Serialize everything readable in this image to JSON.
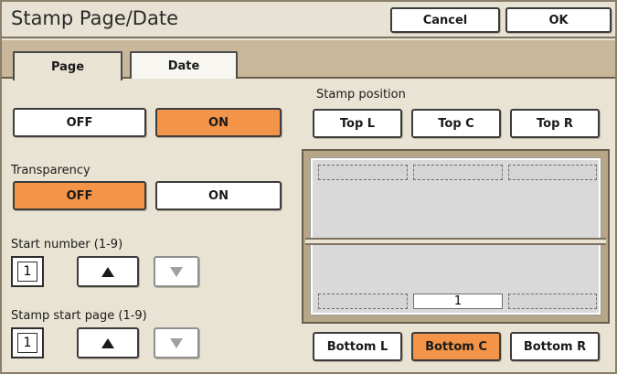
{
  "window": {
    "title": "Stamp Page/Date"
  },
  "header": {
    "cancel_label": "Cancel",
    "ok_label": "OK"
  },
  "tabs": [
    {
      "label": "Page",
      "active": true
    },
    {
      "label": "Date",
      "active": false
    }
  ],
  "stamp_toggle": {
    "off_label": "OFF",
    "on_label": "ON",
    "selected": "ON"
  },
  "transparency": {
    "label": "Transparency",
    "off_label": "OFF",
    "on_label": "ON",
    "selected": "OFF"
  },
  "start_number": {
    "label": "Start number (1-9)",
    "value": "1"
  },
  "stamp_start_page": {
    "label": "Stamp start page (1-9)",
    "value": "1"
  },
  "stamp_position": {
    "label": "Stamp position",
    "top": [
      "Top L",
      "Top C",
      "Top R"
    ],
    "bottom": [
      "Bottom L",
      "Bottom C",
      "Bottom R"
    ],
    "selected": "Bottom C"
  },
  "preview": {
    "page_number": "1"
  },
  "colors": {
    "selected": "#f39448",
    "tab_strip": "#c8b79a",
    "background": "#e9e3d3"
  }
}
